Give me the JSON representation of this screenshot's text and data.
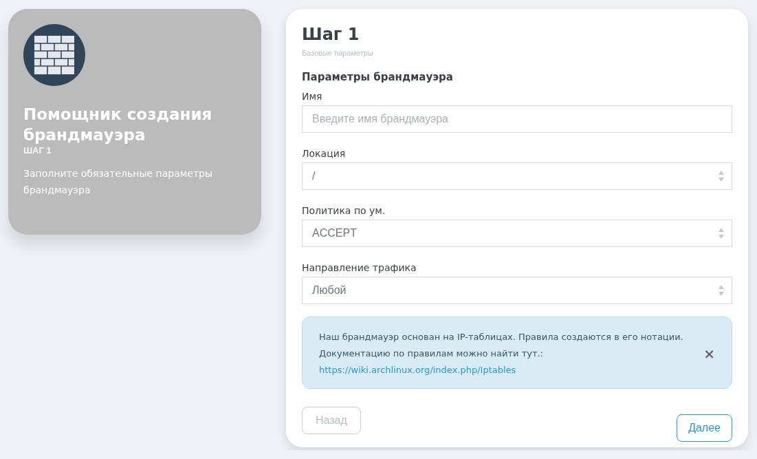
{
  "sidebar": {
    "title": "Помощник создания брандмауэра",
    "step": "ШАГ 1",
    "description": "Заполните обязательные параметры брандмауэра"
  },
  "form": {
    "title": "Шаг 1",
    "subtitle": "Базовые параметры",
    "section": "Параметры брандмауэра",
    "fields": [
      {
        "kind": "text",
        "label": "Имя",
        "placeholder": "Введите имя брандмауэра"
      },
      {
        "kind": "select",
        "label": "Локация",
        "value": "/"
      },
      {
        "kind": "select",
        "label": "Политика по ум.",
        "value": "ACCEPT"
      },
      {
        "kind": "select",
        "label": "Направление трафика",
        "value": "Любой"
      }
    ],
    "alert": {
      "text": "Наш брандмауэр основан на IP-таблицах. Правила создаются в его нотации. Документацию по правилам можно найти тут.:",
      "link": "https://wiki.archlinux.org/index.php/Iptables",
      "close": "×"
    },
    "buttons": [
      {
        "label": "Назад",
        "disabled": true
      },
      {
        "label": "Далее",
        "disabled": false
      }
    ]
  }
}
